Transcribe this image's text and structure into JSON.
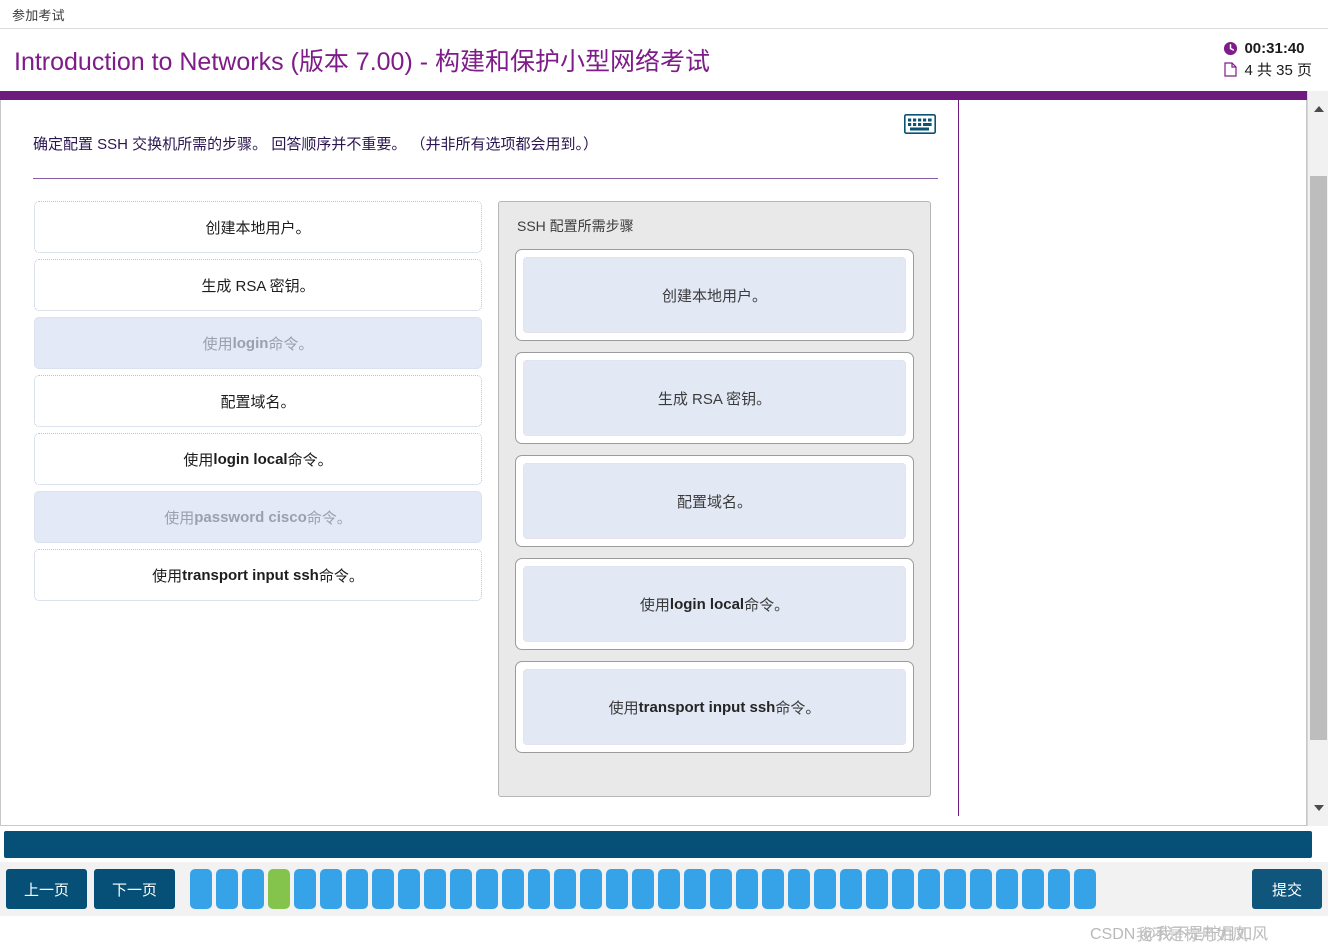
{
  "browser_tab": {
    "label": "参加考试"
  },
  "header": {
    "title": "Introduction to Networks (版本 7.00) - 构建和保护小型网络考试",
    "timer": "00:31:40",
    "timer_icon": "clock-icon",
    "page_counter": "4 共 35 页",
    "page_icon": "document-icon",
    "accent_color": "#7e1c89"
  },
  "question": {
    "keyboard_icon": "keyboard-icon",
    "text": "确定配置 SSH 交换机所需的步骤。 回答顺序并不重要。 （并非所有选项都会用到。）"
  },
  "source_options": [
    {
      "prefix": "",
      "bold": "",
      "suffix": "创建本地用户。",
      "used": false
    },
    {
      "prefix": "",
      "bold": "",
      "suffix": "生成 RSA 密钥。",
      "used": false
    },
    {
      "prefix": "使用 ",
      "bold": "login",
      "suffix": " 命令。",
      "used": true
    },
    {
      "prefix": "",
      "bold": "",
      "suffix": "配置域名。",
      "used": false
    },
    {
      "prefix": "使用 ",
      "bold": "login local",
      "suffix": " 命令。",
      "used": false
    },
    {
      "prefix": "使用 ",
      "bold": "password cisco",
      "suffix": " 命令。",
      "used": true
    },
    {
      "prefix": "使用 ",
      "bold": "transport input ssh",
      "suffix": " 命令。",
      "used": false
    }
  ],
  "drop_zone": {
    "title": "SSH 配置所需步骤",
    "items": [
      {
        "prefix": "",
        "bold": "",
        "suffix": "创建本地用户。"
      },
      {
        "prefix": "",
        "bold": "",
        "suffix": "生成 RSA 密钥。"
      },
      {
        "prefix": "",
        "bold": "",
        "suffix": "配置域名。"
      },
      {
        "prefix": "使用 ",
        "bold": "login local",
        "suffix": " 命令。"
      },
      {
        "prefix": "使用 ",
        "bold": "transport input ssh",
        "suffix": " 命令。"
      }
    ]
  },
  "bottom_nav": {
    "prev_label": "上一页",
    "next_label": "下一页",
    "submit_label": "提交",
    "total_pages": 35,
    "current_page": 4,
    "square_color": "#36a2e8",
    "current_square_color": "#84c44d",
    "bar_color": "#065077"
  },
  "watermark": {
    "text": "CSDN @我不是柠月如风",
    "overlay": "我不是柠月如风"
  }
}
